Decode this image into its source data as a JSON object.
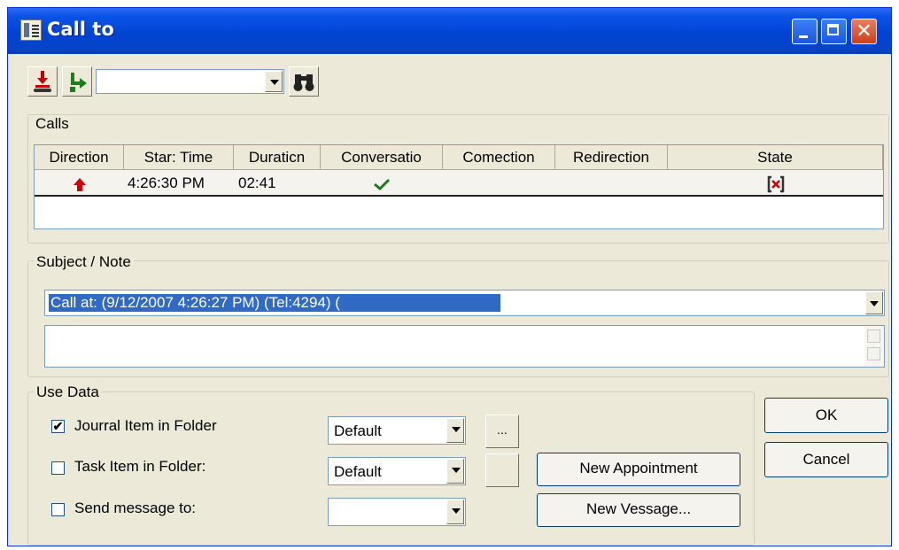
{
  "window": {
    "title": "Call to",
    "colors": {
      "titlebar": "#0a53e8",
      "face": "#ece9d8",
      "selection": "#316ac5",
      "arrow": "#d00000",
      "check": "#1c7a1c"
    }
  },
  "toolbar": {
    "tool1_icon": "hangup-icon",
    "tool2_icon": "transfer-icon",
    "combo_value": "",
    "find_icon": "binoculars-icon"
  },
  "calls": {
    "legend": "Calls",
    "columns": [
      "Direction",
      "Star: Time",
      "Duraticn",
      "Conversatio",
      "Comection",
      "Redirection",
      "State"
    ],
    "row": {
      "direction_icon": "up-arrow-icon",
      "start_time": "4:26:30 PM",
      "duration": "02:41",
      "conversation_icon": "checkmark-icon",
      "connection": "",
      "redirection": "",
      "state_icon": "call-state-icon"
    }
  },
  "subject": {
    "legend": "Subject / Note",
    "value": "Call at:  (9/12/2007 4:26:27 PM) (Tel:4294) (",
    "notes": ""
  },
  "use_data": {
    "legend": "Use Data",
    "journal": {
      "label": "Jourral Item in Folder",
      "checked": true,
      "folder": "Default"
    },
    "task": {
      "label": "Task Item in Folder:",
      "checked": false,
      "folder": "Default"
    },
    "message": {
      "label": "Send message to:",
      "checked": false,
      "folder": ""
    },
    "browse_label": "...",
    "new_appointment": "New Appointment",
    "new_message": "New Vessage..."
  },
  "buttons": {
    "ok": "OK",
    "cancel": "Cancel"
  }
}
